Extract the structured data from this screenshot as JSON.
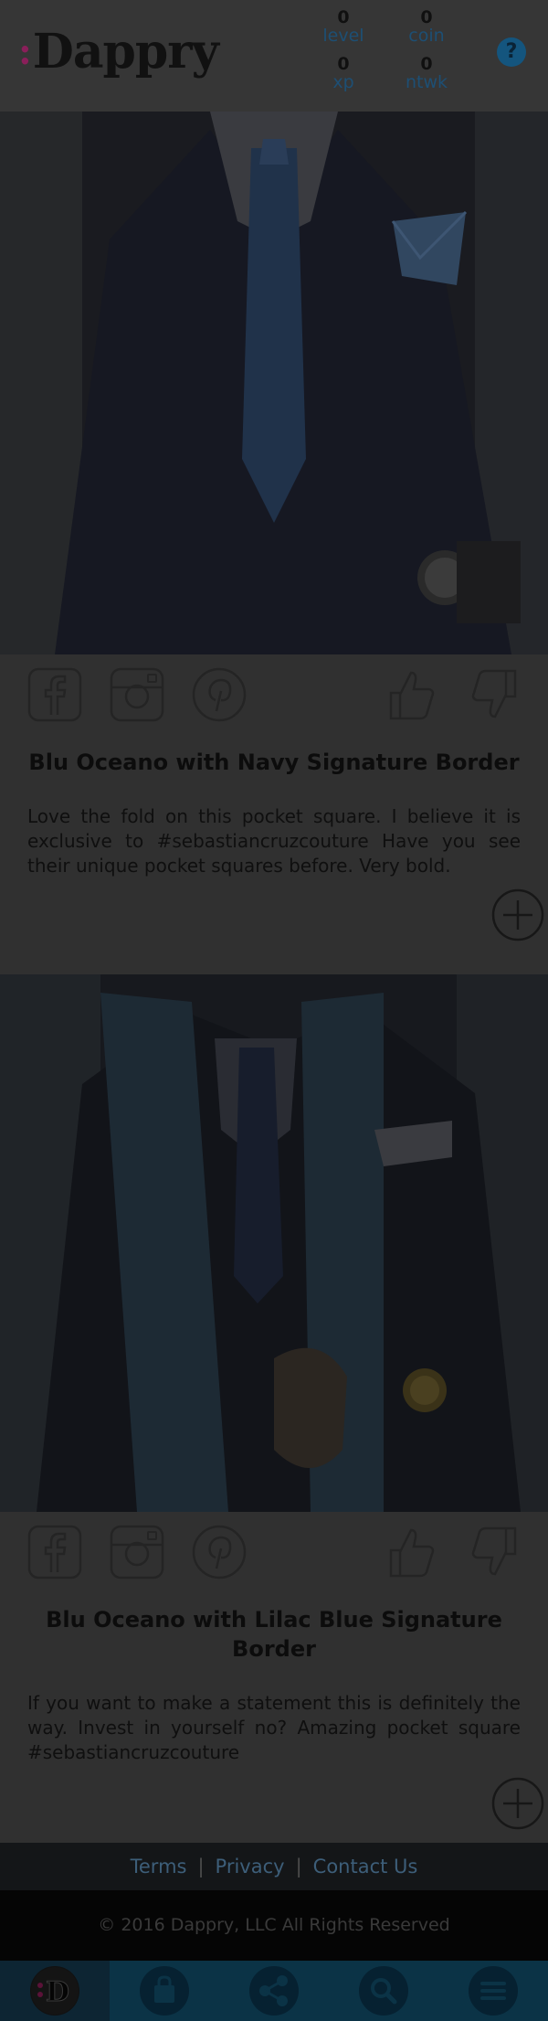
{
  "app": {
    "logo": "Dappry",
    "logo_mark": ":"
  },
  "stats": [
    {
      "value": "0",
      "label": "level"
    },
    {
      "value": "0",
      "label": "coin"
    },
    {
      "value": "0",
      "label": "xp"
    },
    {
      "value": "0",
      "label": "ntwk"
    }
  ],
  "help": {
    "label": "?"
  },
  "posts": [
    {
      "title": "Blu Oceano with Navy Signature Border",
      "text": "Love the fold on this pocket square. I believe it is exclusive to #sebastiancruzcouture Have you see their unique pocket squares before. Very bold."
    },
    {
      "title": "Blu Oceano with Lilac Blue Signature Border",
      "text": "If you want to make a statement this is definitely the way. Invest in yourself no? Amazing pocket square #sebastiancruzcouture"
    }
  ],
  "footer": {
    "links": [
      "Terms",
      "Privacy",
      "Contact Us"
    ],
    "separator": "|",
    "copyright": "© 2016 Dappry, LLC All Rights Reserved"
  },
  "nav": {
    "items": [
      "home-logo",
      "shop-bag-icon",
      "share-icon",
      "search-icon",
      "menu-icon"
    ],
    "logo_letter": "D"
  },
  "colors": {
    "accent": "#8a1f5a",
    "link": "#3d5e79",
    "nav_bg": "#0b3346",
    "stat_label": "#1d4f74"
  }
}
